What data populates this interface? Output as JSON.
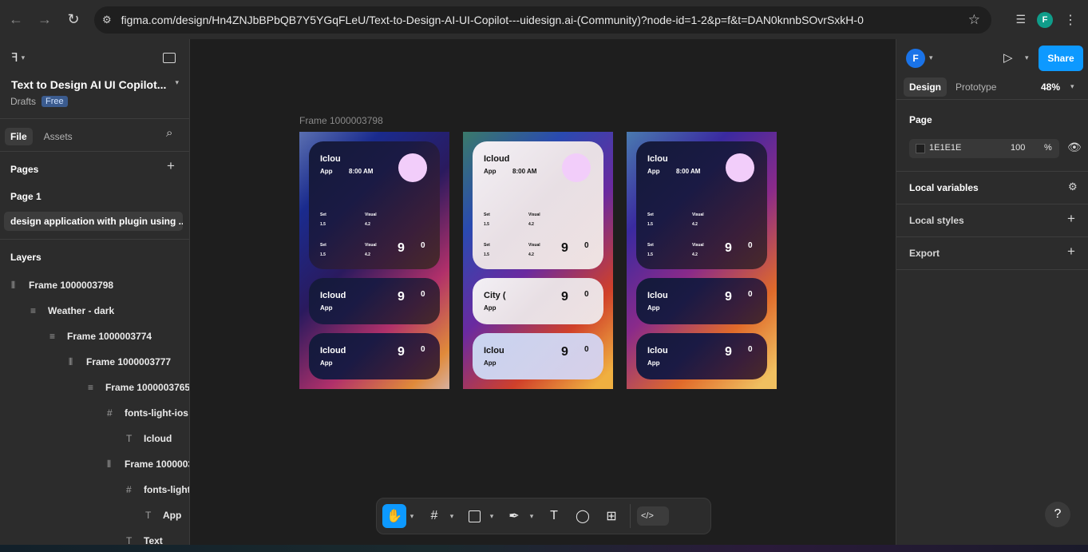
{
  "browser": {
    "url": "figma.com/design/Hn4ZNJbBPbQB7Y5YGqFLeU/Text-to-Design-AI-UI-Copilot---uidesign.ai-(Community)?node-id=1-2&p=f&t=DAN0knnbSOvrSxkH-0",
    "profile_initial": "F"
  },
  "left": {
    "file_title": "Text to Design AI UI Copilot...",
    "drafts": "Drafts",
    "plan_badge": "Free",
    "tabs": [
      "File",
      "Assets"
    ],
    "pages_header": "Pages",
    "pages": [
      "Page 1",
      "design application with plugin using ..."
    ],
    "layers_header": "Layers",
    "layers": [
      {
        "icon": "frame-auto-layout-icon",
        "glyph": "⫴",
        "label": "Frame 1000003798",
        "indent": 0
      },
      {
        "icon": "stack-icon",
        "glyph": "≡",
        "label": "Weather - dark",
        "indent": 1
      },
      {
        "icon": "stack-icon",
        "glyph": "≡",
        "label": "Frame 1000003774",
        "indent": 2
      },
      {
        "icon": "frame-auto-layout-icon",
        "glyph": "⫴",
        "label": "Frame 1000003777",
        "indent": 3
      },
      {
        "icon": "stack-icon",
        "glyph": "≡",
        "label": "Frame 1000003765",
        "indent": 4
      },
      {
        "icon": "frame-icon",
        "glyph": "#",
        "label": "fonts-light-ios",
        "indent": 5
      },
      {
        "icon": "text-icon",
        "glyph": "T",
        "label": "Icloud",
        "indent": 6
      },
      {
        "icon": "frame-auto-layout-icon",
        "glyph": "⫴",
        "label": "Frame 1000003",
        "indent": 5
      },
      {
        "icon": "frame-icon",
        "glyph": "#",
        "label": "fonts-light-",
        "indent": 6
      },
      {
        "icon": "text-icon",
        "glyph": "T",
        "label": "App",
        "indent": 7
      },
      {
        "icon": "text-icon",
        "glyph": "T",
        "label": "Text",
        "indent": 6
      }
    ]
  },
  "canvas": {
    "frame_label": "Frame 1000003798",
    "phones": [
      {
        "big_title": "Iclou",
        "big_app": "App",
        "big_time": "8:00 AM",
        "small": [
          {
            "title": "Icloud",
            "app": "App"
          },
          {
            "title": "Icloud",
            "app": "App"
          }
        ]
      },
      {
        "big_title": "Icloud",
        "big_app": "App",
        "big_time": "8:00 AM",
        "small": [
          {
            "title": "City (",
            "app": "App"
          },
          {
            "title": "Iclou",
            "app": "App"
          }
        ]
      },
      {
        "big_title": "Iclou",
        "big_app": "App",
        "big_time": "8:00 AM",
        "small": [
          {
            "title": "Iclou",
            "app": "App"
          },
          {
            "title": "Iclou",
            "app": "App"
          }
        ]
      }
    ],
    "stat_labels": [
      "Set",
      "Visual",
      "Set",
      "Visual"
    ],
    "stat_values": [
      "1.5",
      "4.2",
      "1.5",
      "4.2"
    ],
    "big_number": "9",
    "small_number": "0"
  },
  "toolbar": {
    "tools": [
      "hand-icon",
      "frame-tool-icon",
      "rectangle-icon",
      "pen-icon",
      "text-tool-icon",
      "comment-icon",
      "resources-icon",
      "dev-mode-icon"
    ]
  },
  "right": {
    "avatar": "F",
    "share": "Share",
    "tabs": [
      "Design",
      "Prototype"
    ],
    "zoom": "48%",
    "page_section": "Page",
    "fill_hex": "1E1E1E",
    "fill_opacity": "100",
    "percent": "%",
    "sections": [
      "Local variables",
      "Local styles",
      "Export"
    ],
    "help": "?"
  },
  "colors": {
    "accent": "#0d99ff",
    "panel": "#2c2c2c",
    "canvas": "#1e1e1e"
  }
}
